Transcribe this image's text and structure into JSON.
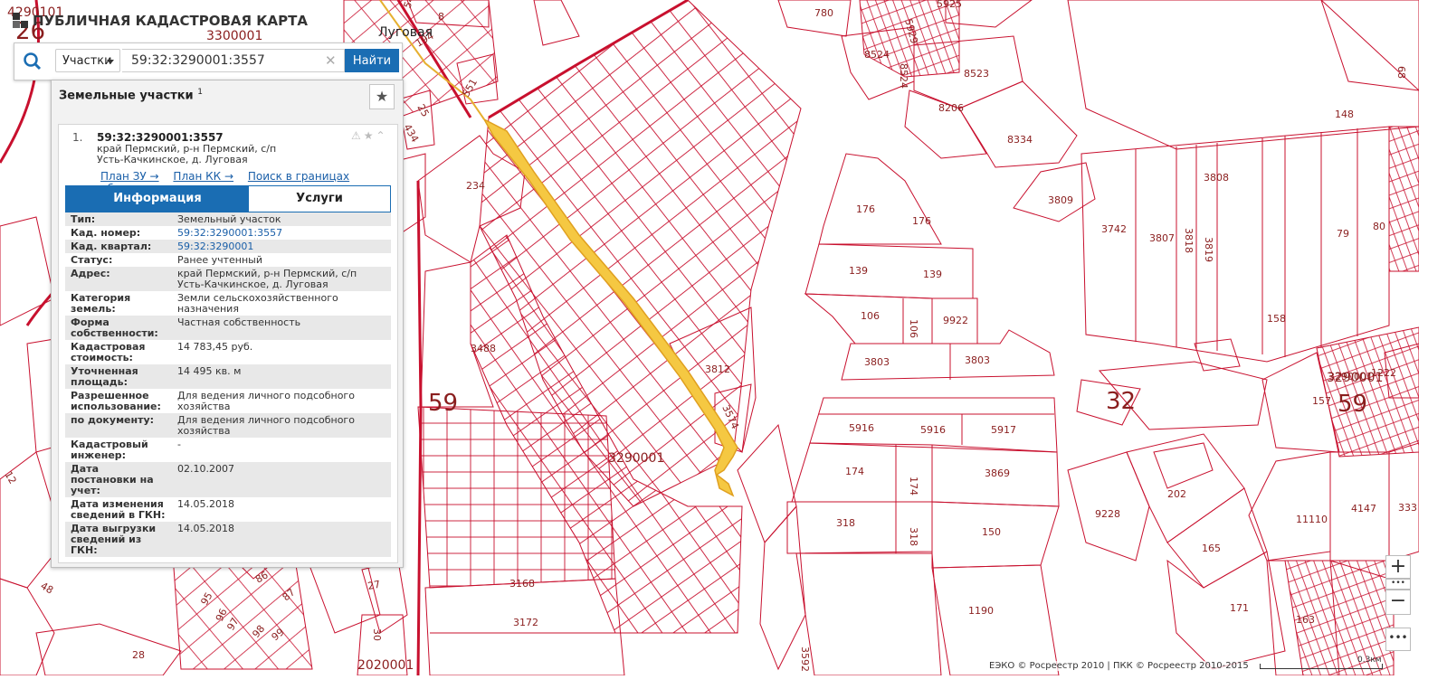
{
  "app": {
    "title": "ПУБЛИЧНАЯ КАДАСТРОВАЯ КАРТА"
  },
  "search": {
    "type_label": "Участки",
    "value": "59:32:3290001:3557",
    "button_label": "Найти"
  },
  "panel": {
    "title": "Земельные участки",
    "count": "1",
    "result": {
      "index": "1.",
      "cad_number": "59:32:3290001:3557",
      "address": "край Пермский, р-н Пермский, с/п Усть-Качкинское, д. Луговая",
      "links": [
        "План ЗУ →",
        "План КК →",
        "Поиск в границах объекта →"
      ]
    },
    "tabs": {
      "info": "Информация",
      "services": "Услуги"
    },
    "fields": [
      {
        "k": "Тип:",
        "v": "Земельный участок"
      },
      {
        "k": "Кад. номер:",
        "v": "59:32:3290001:3557",
        "link": true
      },
      {
        "k": "Кад. квартал:",
        "v": "59:32:3290001",
        "link": true
      },
      {
        "k": "Статус:",
        "v": "Ранее учтенный"
      },
      {
        "k": "Адрес:",
        "v": "край Пермский, р-н Пермский, с/п Усть-Качкинское, д. Луговая"
      },
      {
        "k": "Категория земель:",
        "v": "Земли сельскохозяйственного назначения"
      },
      {
        "k": "Форма собственности:",
        "v": "Частная собственность"
      },
      {
        "k": "Кадастровая стоимость:",
        "v": "14 783,45 руб."
      },
      {
        "k": "Уточненная площадь:",
        "v": "14 495 кв. м"
      },
      {
        "k": "Разрешенное использование:",
        "v": "Для ведения личного подсобного хозяйства"
      },
      {
        "k": "по документу:",
        "v": "Для ведения личного подсобного хозяйства"
      },
      {
        "k": "Кадастровый инженер:",
        "v": "-"
      },
      {
        "k": "Дата постановки на учет:",
        "v": "02.10.2007"
      },
      {
        "k": "Дата изменения сведений в ГКН:",
        "v": "14.05.2018"
      },
      {
        "k": "Дата выгрузки сведений из ГКН:",
        "v": "14.05.2018"
      }
    ]
  },
  "map": {
    "district_labels": [
      "59",
      "32",
      "59",
      "26"
    ],
    "quarter_labels": [
      "3290001",
      "3290001",
      "3300001",
      "2020001",
      "4290101"
    ],
    "place_name": "Луговая",
    "parcel_labels": [
      "780",
      "5925",
      "5929",
      "8524",
      "8524",
      "8523",
      "8206",
      "8334",
      "148",
      "68",
      "3809",
      "3808",
      "3742",
      "3807",
      "3818",
      "3819",
      "79",
      "80",
      "158",
      "176",
      "176",
      "139",
      "139",
      "106",
      "106",
      "9922",
      "3803",
      "3803",
      "3812",
      "3488",
      "3290001",
      "3574",
      "5916",
      "5916",
      "5917",
      "174",
      "174",
      "3869",
      "318",
      "318",
      "150",
      "1190",
      "9228",
      "202",
      "165",
      "171",
      "11110",
      "4147",
      "333",
      "163",
      "157",
      "1222",
      "3168",
      "3172",
      "234",
      "551",
      "194",
      "27",
      "30",
      "95",
      "96",
      "97",
      "98",
      "99",
      "86",
      "87",
      "28",
      "48",
      "12",
      "434",
      "25",
      "3592",
      "541",
      "8"
    ]
  },
  "controls": {
    "zoom_in": "+",
    "zoom_out": "−",
    "more": "•••"
  },
  "footer": {
    "copyright": "ЕЭКО © Росреестр 2010 | ПКК © Росреестр 2010-2015",
    "scale": "0.3км"
  },
  "colors": {
    "parcel_line": "#c8102e",
    "accent": "#1a6db3",
    "highlight": "#f5c842"
  }
}
